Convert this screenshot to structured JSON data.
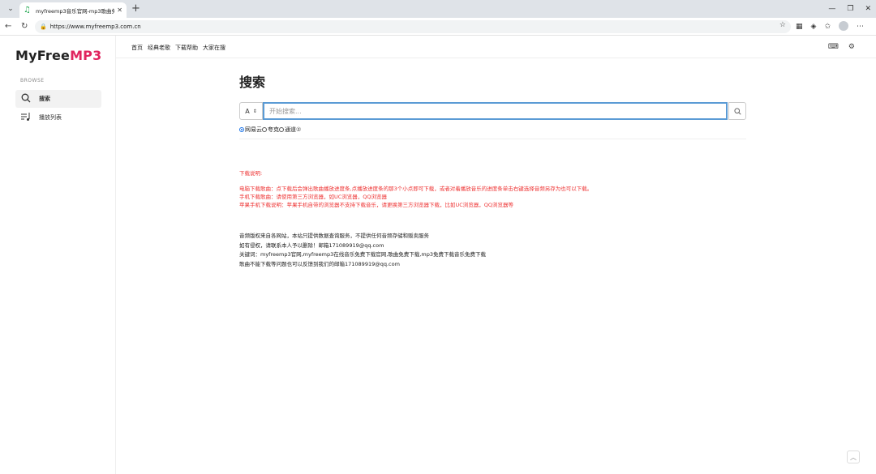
{
  "browser": {
    "tab_title": "myfreemp3音乐官网-mp3歌曲免",
    "url": "https://www.myfreemp3.com.cn"
  },
  "logo": {
    "part1": "MyFree",
    "part2": "MP3"
  },
  "sidebar": {
    "section_label": "BROWSE",
    "items": [
      {
        "label": "搜索",
        "icon": "search-icon"
      },
      {
        "label": "播放列表",
        "icon": "playlist-icon"
      }
    ]
  },
  "topnav": {
    "links": [
      "首页",
      "经典老歌",
      "下载帮助",
      "大家在搜"
    ]
  },
  "main": {
    "title": "搜索",
    "source_select": "A",
    "search_placeholder": "开始搜索...",
    "sources": [
      {
        "label": "网易云",
        "checked": true
      },
      {
        "label": "夸克",
        "checked": false
      },
      {
        "label": "通道",
        "checked": false
      }
    ],
    "help_icon": "②"
  },
  "notes_red": [
    "下载说明:",
    "电脑下载歌曲：点下载后会弹出歌曲播放进度条,点播放进度条的那3个小点即可下载，或者对着播放音乐的进度条单击右键选择音频另存为也可以下载。",
    "手机下载歌曲：请使用第三方浏览器，如UC浏览器，QQ浏览器",
    "苹果手机下载说明：苹果手机自带的浏览器不支持下载音乐，请更换第三方浏览器下载，比如UC浏览器，QQ浏览器等"
  ],
  "notes_black": [
    "音频版权来自各网站，本站只提供数据查询服务，不提供任何音频存储和贩卖服务",
    "如有侵权，请联系本人予以删除！邮箱171089919@qq.com",
    "关键词：myfreemp3官网,myfreemp3在线音乐免费下载官网,歌曲免费下载,mp3免费下载音乐免费下载",
    "歌曲不能下载等问题也可以反馈到我们的邮箱171089919@qq.com"
  ]
}
